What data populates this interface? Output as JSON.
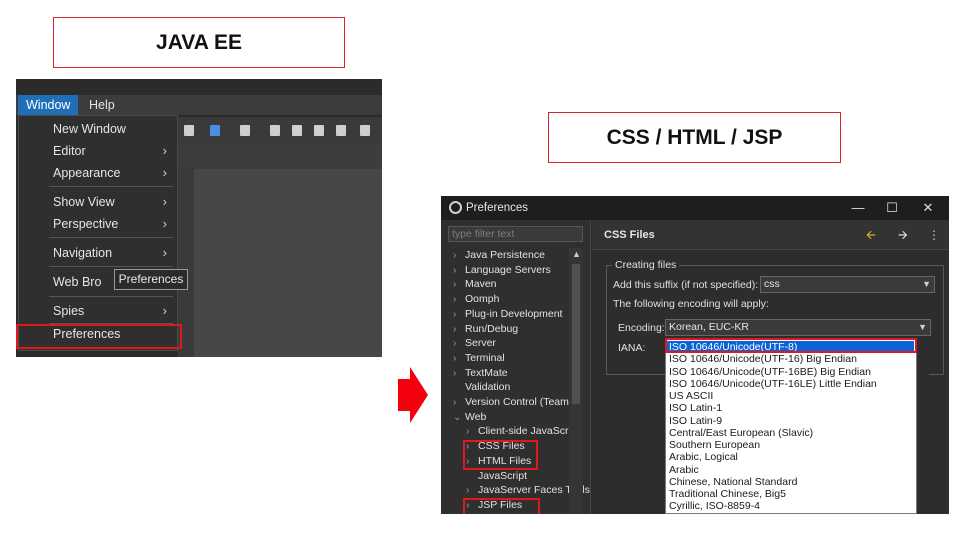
{
  "titles": {
    "left": "JAVA  EE",
    "right": "CSS / HTML / JSP"
  },
  "eclipse": {
    "menubar": [
      "Window",
      "Help"
    ],
    "window_menu": [
      {
        "label": "New Window",
        "submenu": false
      },
      {
        "label": "Editor",
        "submenu": true
      },
      {
        "label": "Appearance",
        "submenu": true
      },
      {
        "label": "Show View",
        "submenu": true
      },
      {
        "label": "Perspective",
        "submenu": true
      },
      {
        "label": "Navigation",
        "submenu": true
      },
      {
        "label": "Web Bro",
        "submenu": false
      },
      {
        "label": "Spies",
        "submenu": true
      },
      {
        "label": "Preferences",
        "submenu": false
      }
    ],
    "tooltip": "Preferences",
    "submenu_glyph": ">"
  },
  "prefs": {
    "title": "Preferences",
    "window_buttons": [
      "—",
      "☐",
      "✕"
    ],
    "filter_placeholder": "type filter text",
    "tree": [
      {
        "label": "Java Persistence",
        "chev": ">"
      },
      {
        "label": "Language Servers",
        "chev": ">"
      },
      {
        "label": "Maven",
        "chev": ">"
      },
      {
        "label": "Oomph",
        "chev": ">"
      },
      {
        "label": "Plug-in Development",
        "chev": ">"
      },
      {
        "label": "Run/Debug",
        "chev": ">"
      },
      {
        "label": "Server",
        "chev": ">"
      },
      {
        "label": "Terminal",
        "chev": ">"
      },
      {
        "label": "TextMate",
        "chev": ">"
      },
      {
        "label": "Validation",
        "chev": ""
      },
      {
        "label": "Version Control (Team)",
        "chev": ">"
      },
      {
        "label": "Web",
        "chev": "v"
      },
      {
        "label": "Client-side JavaScript",
        "chev": ">"
      },
      {
        "label": "CSS Files",
        "chev": ">"
      },
      {
        "label": "HTML Files",
        "chev": ">"
      },
      {
        "label": "JavaScript",
        "chev": ""
      },
      {
        "label": "JavaServer Faces Tools",
        "chev": ">"
      },
      {
        "label": "JSP Files",
        "chev": ">"
      }
    ],
    "page_title": "CSS Files",
    "group_title": "Creating files",
    "suffix_label": "Add this suffix (if not specified):",
    "suffix_value": "css",
    "encoding_note": "The following encoding will apply:",
    "encoding_label": "Encoding:",
    "encoding_value": "Korean, EUC-KR",
    "iana_label": "IANA:",
    "encodings": [
      "ISO 10646/Unicode(UTF-8)",
      "ISO 10646/Unicode(UTF-16) Big Endian",
      "ISO 10646/Unicode(UTF-16BE) Big Endian",
      "ISO 10646/Unicode(UTF-16LE) Little Endian",
      "US ASCII",
      "ISO Latin-1",
      "ISO Latin-9",
      "Central/East European (Slavic)",
      "Southern European",
      "Arabic, Logical",
      "Arabic",
      "Chinese, National Standard",
      "Traditional Chinese, Big5",
      "Cyrillic, ISO-8859-4"
    ],
    "colors": {
      "highlight": "#e0181d",
      "selection": "#0a64d8",
      "arrow": "#f4000f"
    }
  }
}
